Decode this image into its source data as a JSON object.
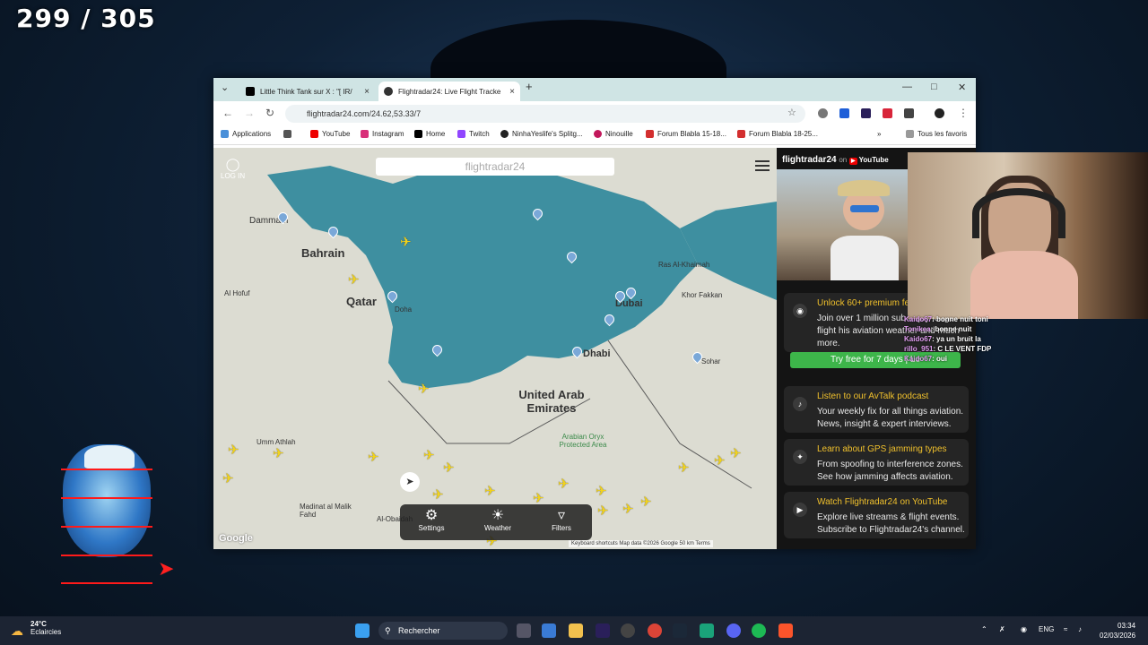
{
  "overlay": {
    "counter": "299 / 305"
  },
  "browser": {
    "tabs": [
      {
        "label": "Little Think Tank sur X : \"[ ⁣IR/",
        "active": false
      },
      {
        "label": "Flightradar24: Live Flight Tracke",
        "active": true
      }
    ],
    "url": "flightradar24.com/24.62,53.33/7",
    "bookmarks": [
      "Applications",
      "YouTube",
      "Instagram",
      "Home",
      "Twitch",
      "NinhaYeslife's Splitg...",
      "Ninouille",
      "Forum Blabla 15-18...",
      "Forum Blabla 18-25...",
      "Tous les favoris"
    ]
  },
  "map": {
    "login": "LOG IN",
    "search_placeholder": "flightradar24",
    "labels": [
      "Bahrain",
      "Qatar",
      "United Arab Emirates",
      "Dubai",
      "Dhabi",
      "Sohar",
      "Ras Al-Khaimah",
      "Khor Fakkan",
      "Dammam",
      "Al Hofuf",
      "Doha",
      "Umm Athlah",
      "Madinat al Malik Fahd",
      "Al-Obaidah",
      "Arabian Oryx Protected Area"
    ],
    "toolbar": {
      "settings": "Settings",
      "weather": "Weather",
      "filters": "Filters"
    },
    "attribution": "Keyboard shortcuts   Map data ©2026 Google   50 km   Terms",
    "google": "Google"
  },
  "sidebar": {
    "brand": "flightradar24",
    "on": "on",
    "youtube": "YouTube",
    "premium": {
      "title": "Unlock 60+ premium fe",
      "body": "Join over 1 million sub enjoy longer flight his aviation weather and much more.",
      "cta": "Try free for 7 days | Le"
    },
    "cards": [
      {
        "title": "Listen to our AvTalk podcast",
        "body": "Your weekly fix for all things aviation. News, insight & expert interviews."
      },
      {
        "title": "Learn about GPS jamming types",
        "body": "From spoofing to interference zones. See how jamming affects aviation."
      },
      {
        "title": "Watch Flightradar24 on YouTube",
        "body": "Explore live streams & flight events. Subscribe to Flightradar24's channel."
      }
    ]
  },
  "chat": [
    {
      "user": "Kaido67",
      "msg": ": bonne nuit toni"
    },
    {
      "user": "Tonikea",
      "msg": ": bonne nuit"
    },
    {
      "user": "Kaido67",
      "msg": ": ya un bruit la"
    },
    {
      "user": "rillo_951",
      "msg": ": C LE VENT FDP"
    },
    {
      "user": "Kaido67",
      "msg": ": oui"
    }
  ],
  "taskbar": {
    "temp": "24°C",
    "condition": "Eclaircies",
    "search": "Rechercher",
    "lang": "ENG",
    "time": "03:34",
    "date": "02/03/2026"
  },
  "colors": {
    "plane": "#f2d31b",
    "sea": "#3e8fa0",
    "cta": "#3db54a",
    "accent": "#f0c02c"
  }
}
